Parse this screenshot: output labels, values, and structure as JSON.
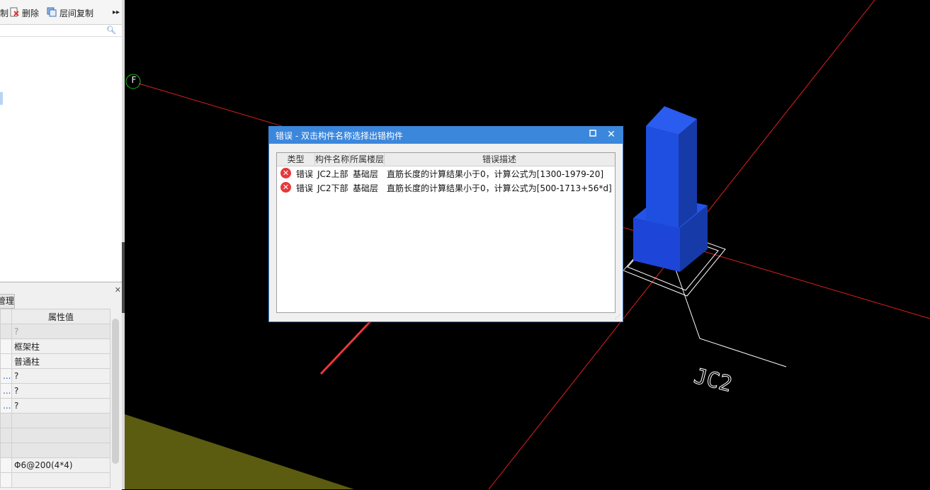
{
  "toolbar": {
    "partial_label": "制",
    "delete_label": "删除",
    "copy_between_floors_label": "层间复制",
    "more_icon": "double-chevron-right-icon"
  },
  "search": {
    "icon": "search-icon"
  },
  "bottom_panel": {
    "tab_label": "管理",
    "property_header": "属性值",
    "rows": [
      {
        "name": "",
        "value": "?"
      },
      {
        "name": "",
        "value": "框架柱"
      },
      {
        "name": "",
        "value": "普通柱"
      },
      {
        "name": "...",
        "value": "?"
      },
      {
        "name": "...",
        "value": "?"
      },
      {
        "name": "...",
        "value": "?"
      },
      {
        "name": "",
        "value": ""
      },
      {
        "name": "",
        "value": ""
      },
      {
        "name": "",
        "value": ""
      },
      {
        "name": "",
        "value": "Φ6@200(4*4)"
      },
      {
        "name": "",
        "value": ""
      }
    ]
  },
  "viewport": {
    "axis_label": "F",
    "component_label": "JC2",
    "colors": {
      "axis": "#e02020",
      "column": "#1f4fe0",
      "ground": "#5c5c10",
      "arrow": "#e8383a"
    }
  },
  "dialog": {
    "title": "错误 - 双击构件名称选择出错构件",
    "columns": [
      "类型",
      "构件名称",
      "所属楼层",
      "错误描述"
    ],
    "rows": [
      {
        "type": "错误",
        "name": "JC2上部",
        "floor": "基础层",
        "desc": "直筋长度的计算结果小于0，计算公式为[1300-1979-20]"
      },
      {
        "type": "错误",
        "name": "JC2下部",
        "floor": "基础层",
        "desc": "直筋长度的计算结果小于0，计算公式为[500-1713+56*d]"
      }
    ]
  }
}
